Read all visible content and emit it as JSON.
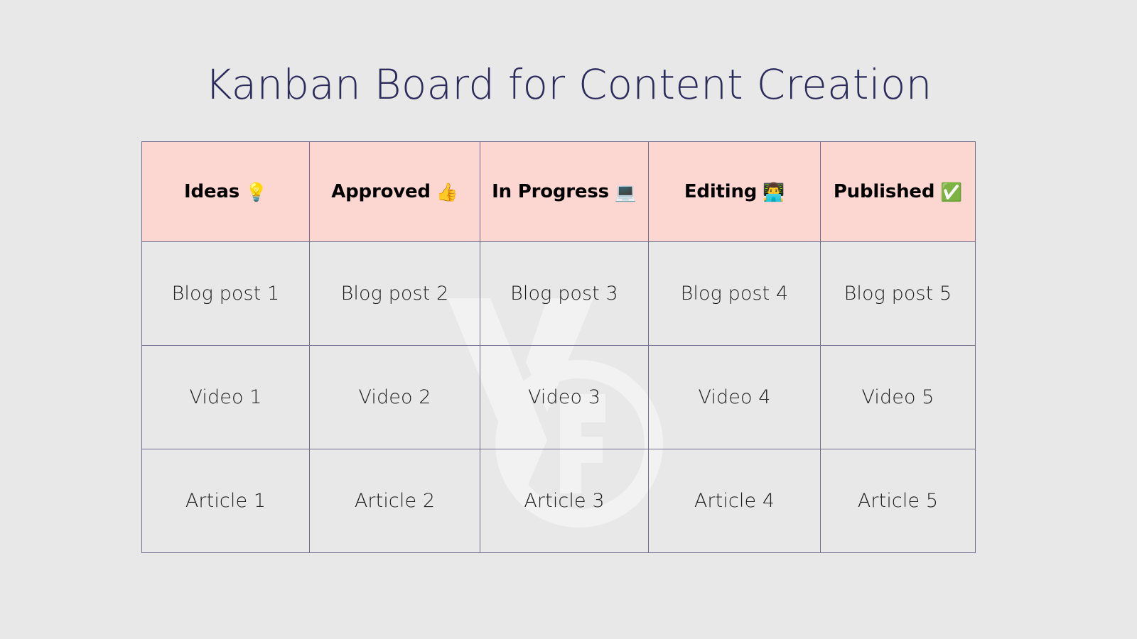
{
  "page": {
    "title": "Kanban Board for Content Creation",
    "background_color": "#e8e8e8",
    "title_color": "#2c2b5c"
  },
  "watermark": {
    "name": "vector-logo-watermark",
    "visible": true
  },
  "board": {
    "header_background_color": "#fcd6d0",
    "border_color": "#6f6d8e",
    "columns": [
      {
        "label": "Ideas",
        "emoji": "💡",
        "emoji_name": "light-bulb-emoji"
      },
      {
        "label": "Approved",
        "emoji": "👍",
        "emoji_name": "thumbs-up-emoji"
      },
      {
        "label": "In Progress",
        "emoji": "💻",
        "emoji_name": "laptop-emoji"
      },
      {
        "label": "Editing",
        "emoji": "👨‍💻",
        "emoji_name": "technologist-emoji"
      },
      {
        "label": "Published",
        "emoji": "✅",
        "emoji_name": "check-mark-button-emoji"
      }
    ],
    "rows": [
      [
        "Blog post 1",
        "Blog post 2",
        "Blog post 3",
        "Blog post 4",
        "Blog post 5"
      ],
      [
        "Video 1",
        "Video 2",
        "Video 3",
        "Video 4",
        "Video 5"
      ],
      [
        "Article 1",
        "Article 2",
        "Article 3",
        "Article 4",
        "Article 5"
      ]
    ]
  }
}
